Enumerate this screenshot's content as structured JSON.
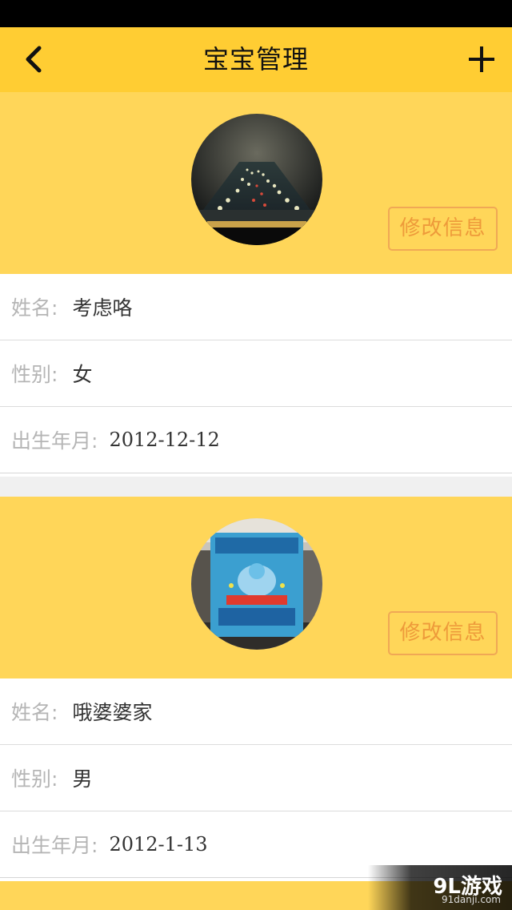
{
  "header": {
    "title": "宝宝管理",
    "back_icon": "chevron-left-icon",
    "add_icon": "plus-icon"
  },
  "babies": [
    {
      "edit_label": "修改信息",
      "name_label": "姓名:",
      "name": "考虑咯",
      "gender_label": "性别:",
      "gender": "女",
      "birth_label": "出生年月:",
      "birth": "2012-12-12",
      "avatar": "night-traffic-photo"
    },
    {
      "edit_label": "修改信息",
      "name_label": "姓名:",
      "name": "哦婆婆家",
      "gender_label": "性别:",
      "gender": "男",
      "birth_label": "出生年月:",
      "birth": "2012-1-13",
      "avatar": "product-box-photo"
    }
  ],
  "watermark": {
    "logo": "9L游戏",
    "url": "91danji.com"
  },
  "colors": {
    "nav_bg": "#ffcd33",
    "header_bg": "#ffd659",
    "edit_accent": "#ee9a3a",
    "label_gray": "#b5b5b5"
  }
}
